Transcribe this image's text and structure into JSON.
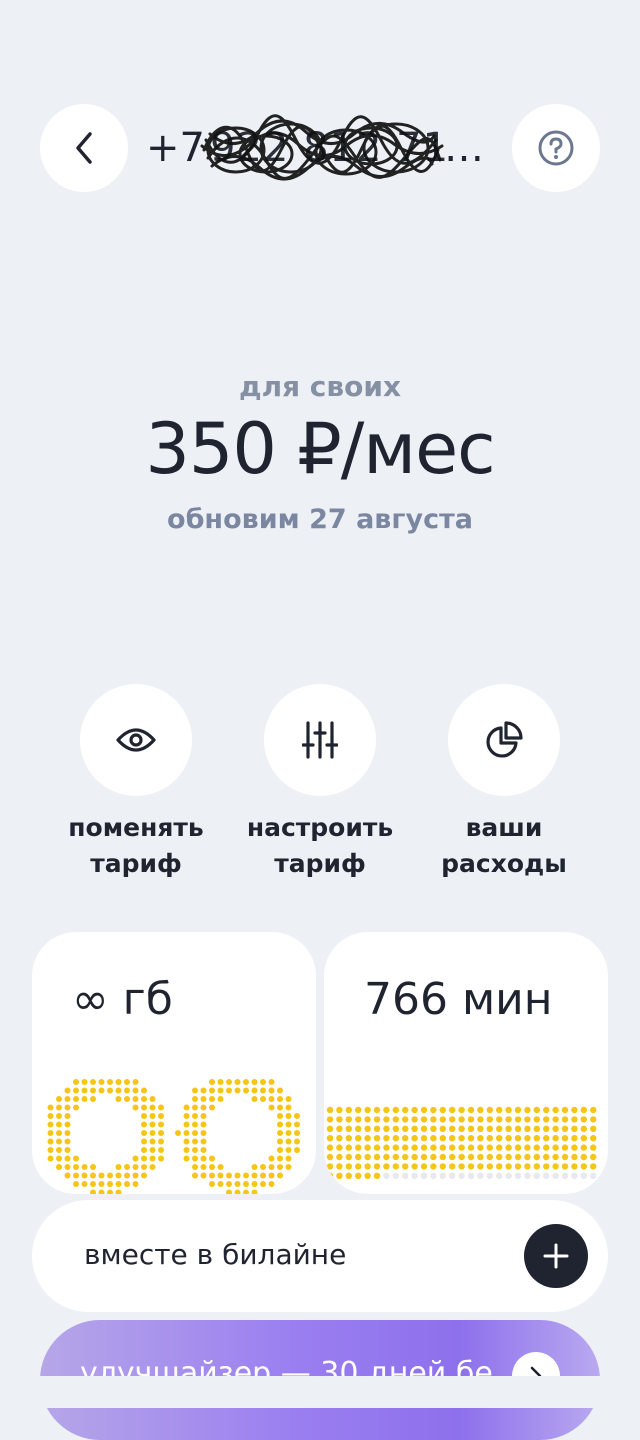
{
  "header": {
    "phone_prefix": "+7",
    "phone_hidden": "922 812 71",
    "phone_ellipsis": "…"
  },
  "tariff": {
    "name": "для своих",
    "price": "350 ₽/мес",
    "renewal": "обновим 27 августа"
  },
  "actions": [
    {
      "label_line1": "поменять",
      "label_line2": "тариф",
      "icon": "eye-icon"
    },
    {
      "label_line1": "настроить",
      "label_line2": "тариф",
      "icon": "sliders-icon"
    },
    {
      "label_line1": "ваши",
      "label_line2": "расходы",
      "icon": "pie-chart-icon"
    }
  ],
  "cards": {
    "data": {
      "value": "∞ гб"
    },
    "minutes": {
      "value": "766 мин",
      "remaining_fraction": 0.9
    }
  },
  "together": {
    "label": "вместе в билайне"
  },
  "promo": {
    "label": "улучшайзер — 30 дней бе"
  },
  "colors": {
    "background": "#edf1f5",
    "accent_yellow": "#f5c518",
    "dark": "#1f2430",
    "muted": "#8590a4",
    "promo_purple": "#9a7ff0"
  }
}
